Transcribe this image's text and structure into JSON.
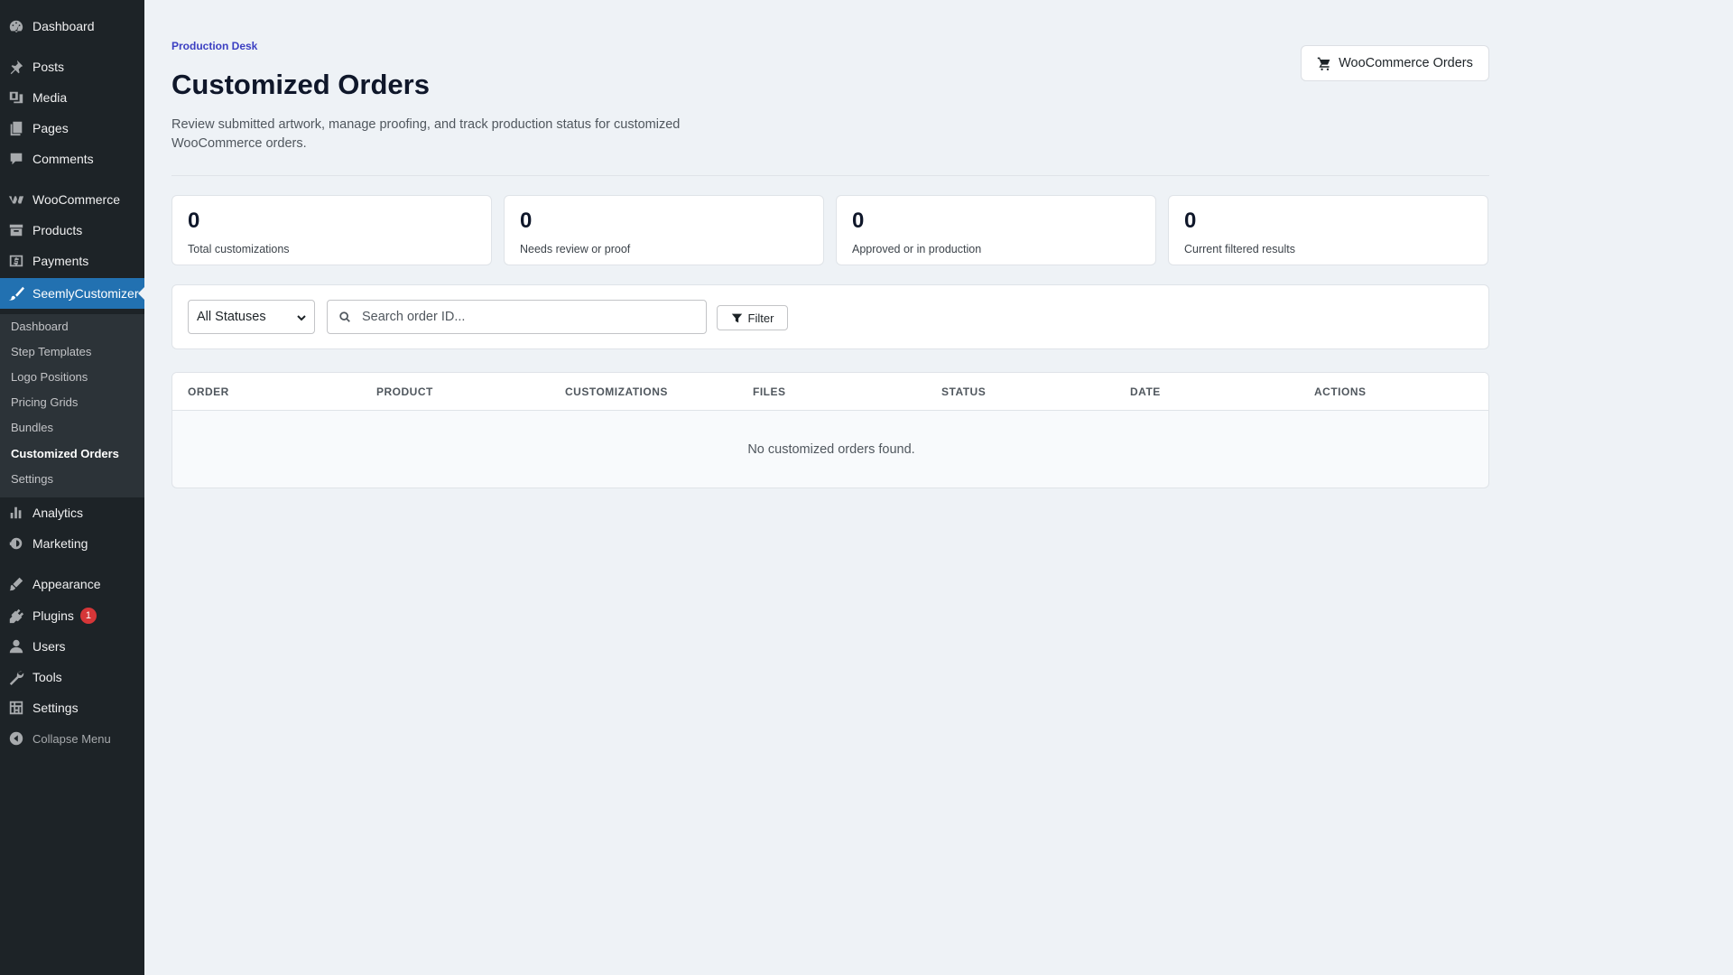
{
  "sidebar": {
    "menu": [
      {
        "label": "Dashboard",
        "icon": "dashboard-icon"
      },
      {
        "label": "Posts",
        "icon": "pin-icon"
      },
      {
        "label": "Media",
        "icon": "media-icon"
      },
      {
        "label": "Pages",
        "icon": "pages-icon"
      },
      {
        "label": "Comments",
        "icon": "comment-icon"
      },
      {
        "label": "WooCommerce",
        "icon": "woo-icon"
      },
      {
        "label": "Products",
        "icon": "archive-icon"
      },
      {
        "label": "Payments",
        "icon": "dollar-icon"
      },
      {
        "label": "SeemlyCustomizer",
        "icon": "brush-icon"
      },
      {
        "label": "Analytics",
        "icon": "bar-chart-icon"
      },
      {
        "label": "Marketing",
        "icon": "megaphone-icon"
      },
      {
        "label": "Appearance",
        "icon": "paintbrush-icon"
      },
      {
        "label": "Plugins",
        "icon": "plugin-icon",
        "badge": "1"
      },
      {
        "label": "Users",
        "icon": "user-icon"
      },
      {
        "label": "Tools",
        "icon": "wrench-icon"
      },
      {
        "label": "Settings",
        "icon": "settings-icon"
      },
      {
        "label": "Collapse Menu",
        "icon": "collapse-icon"
      }
    ],
    "submenu": [
      "Dashboard",
      "Step Templates",
      "Logo Positions",
      "Pricing Grids",
      "Bundles",
      "Customized Orders",
      "Settings"
    ]
  },
  "header": {
    "eyebrow": "Production Desk",
    "title": "Customized Orders",
    "description": "Review submitted artwork, manage proofing, and track production status for customized WooCommerce orders.",
    "woo_button": "WooCommerce Orders"
  },
  "stats": [
    {
      "value": "0",
      "label": "Total customizations"
    },
    {
      "value": "0",
      "label": "Needs review or proof"
    },
    {
      "value": "0",
      "label": "Approved or in production"
    },
    {
      "value": "0",
      "label": "Current filtered results"
    }
  ],
  "filters": {
    "status_selected": "All Statuses",
    "search_placeholder": "Search order ID...",
    "filter_button": "Filter"
  },
  "table": {
    "columns": [
      "ORDER",
      "PRODUCT",
      "CUSTOMIZATIONS",
      "FILES",
      "STATUS",
      "DATE",
      "ACTIONS"
    ],
    "empty_message": "No customized orders found."
  },
  "colors": {
    "sidebar_bg": "#1d2327",
    "active_menu": "#2271b1",
    "eyebrow": "#3b3fc2",
    "badge": "#d63638"
  }
}
